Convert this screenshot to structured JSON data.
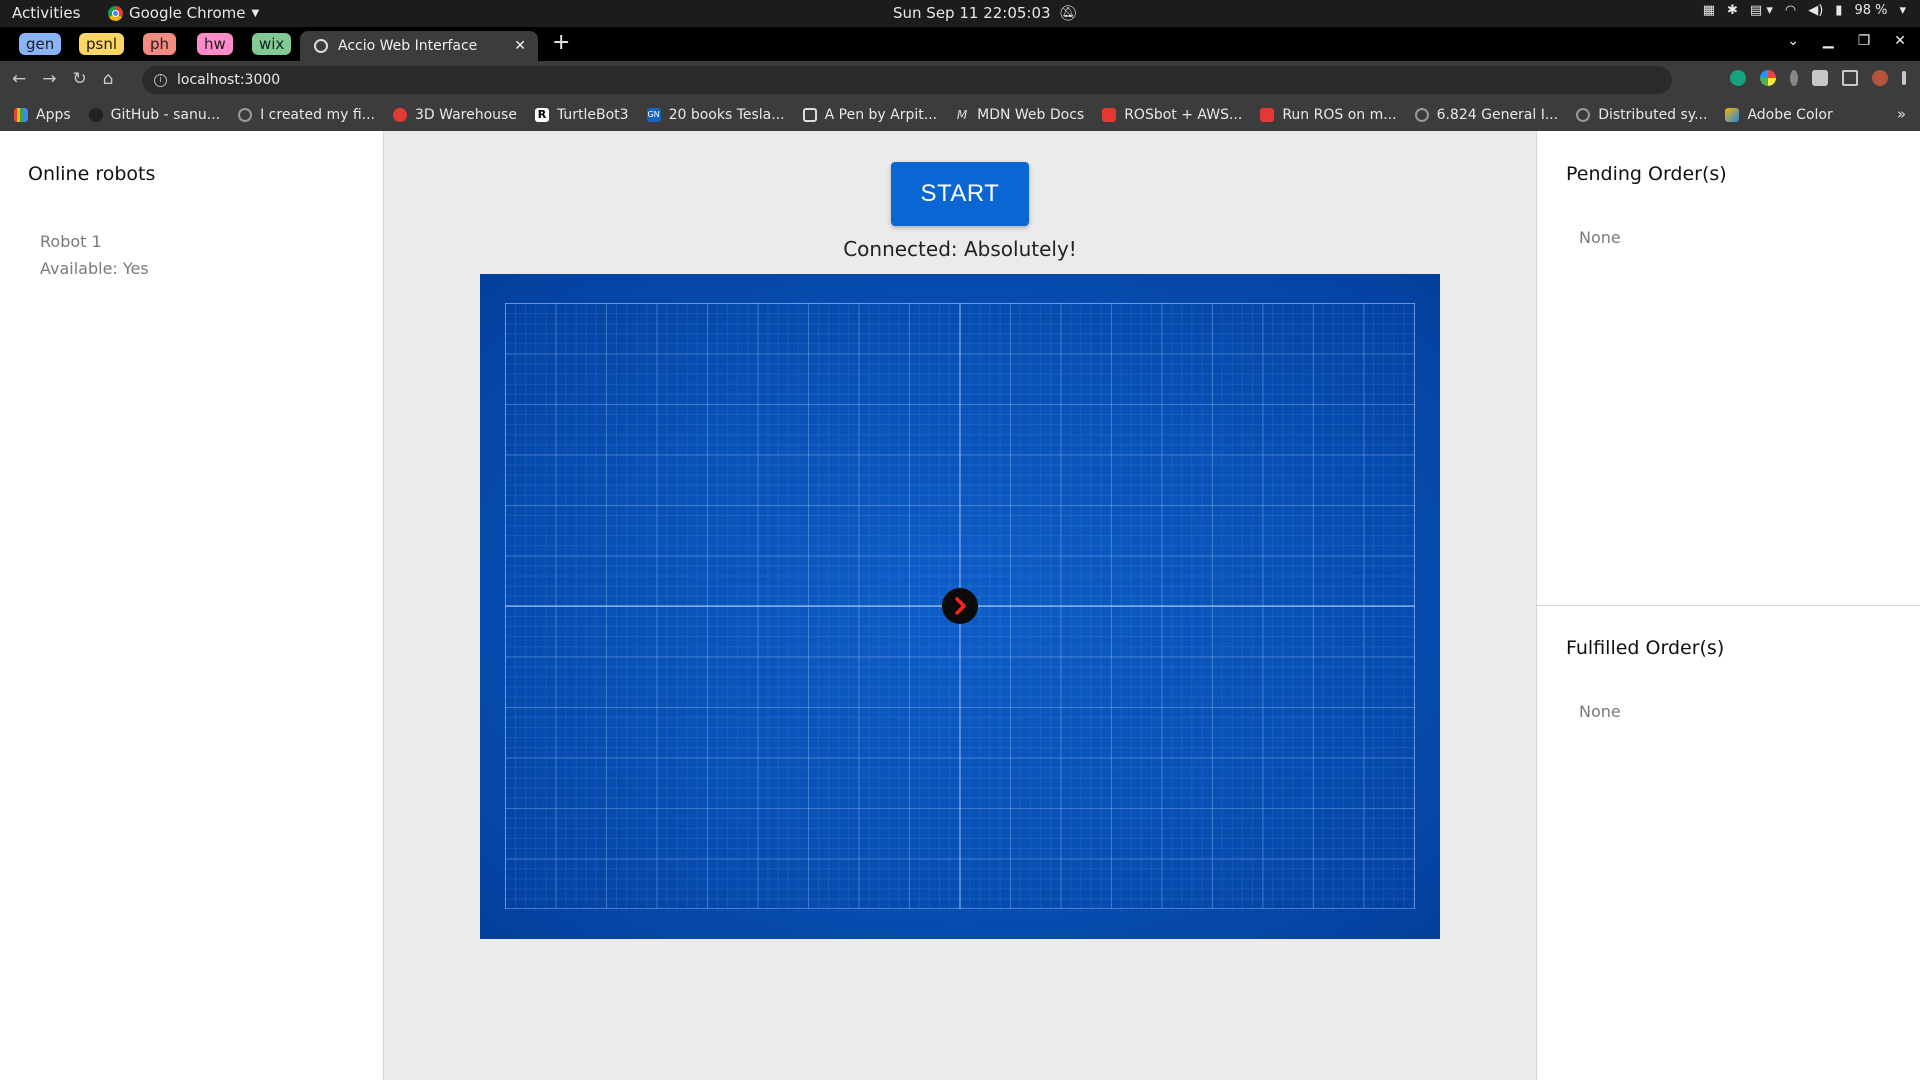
{
  "system_bar": {
    "activities": "Activities",
    "app_name": "Google Chrome",
    "datetime": "Sun Sep 11  22:05:03",
    "battery": "98 %"
  },
  "tabs": {
    "groups": [
      {
        "label": "gen",
        "color": "#8ab4f8"
      },
      {
        "label": "psnl",
        "color": "#fdd663"
      },
      {
        "label": "ph",
        "color": "#f28b82"
      },
      {
        "label": "hw",
        "color": "#ff8bcb"
      },
      {
        "label": "wix",
        "color": "#81c995"
      }
    ],
    "active_title": "Accio Web Interface"
  },
  "omnibox": {
    "url": "localhost:3000"
  },
  "bookmarks": [
    {
      "label": "Apps",
      "color": "#4285f4"
    },
    {
      "label": "GitHub - sanu...",
      "color": "#222222"
    },
    {
      "label": "I created my fi...",
      "color": "#777777"
    },
    {
      "label": "3D Warehouse",
      "color": "#e53935"
    },
    {
      "label": "TurtleBot3",
      "color": "#000000"
    },
    {
      "label": "20 books Tesla...",
      "color": "#1565c0"
    },
    {
      "label": "A Pen by Arpit...",
      "color": "#000000"
    },
    {
      "label": "MDN Web Docs",
      "color": "#000000"
    },
    {
      "label": "ROSbot + AWS...",
      "color": "#e53935"
    },
    {
      "label": "Run ROS on m...",
      "color": "#e53935"
    },
    {
      "label": "6.824 General I...",
      "color": "#777777"
    },
    {
      "label": "Distributed sy...",
      "color": "#777777"
    },
    {
      "label": "Adobe Color",
      "color": "#ffb300"
    }
  ],
  "left_panel": {
    "title": "Online robots",
    "robot_name": "Robot 1",
    "robot_available": "Available: Yes"
  },
  "center": {
    "start_label": "START",
    "status": "Connected: Absolutely!"
  },
  "right_panel": {
    "pending_title": "Pending Order(s)",
    "pending_value": "None",
    "fulfilled_title": "Fulfilled Order(s)",
    "fulfilled_value": "None"
  },
  "colors": {
    "start_button": "#0a66d2",
    "map_blue": "#0850b4",
    "robot_arrow": "#ff2020"
  }
}
